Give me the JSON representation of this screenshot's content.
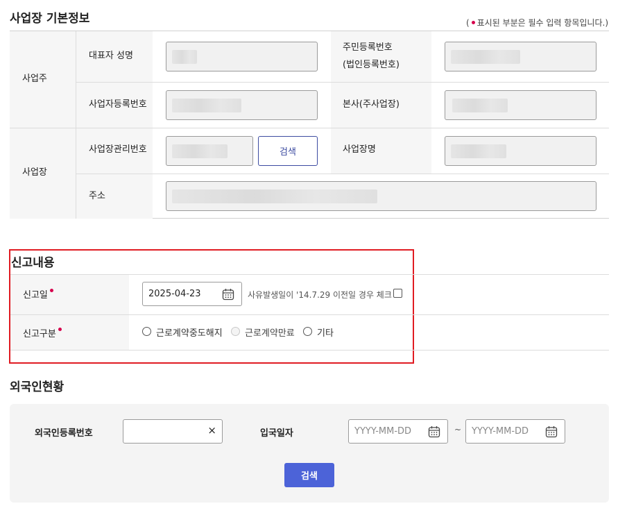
{
  "basic_info": {
    "title": "사업장 기본정보",
    "required_note": "표시된 부분은 필수 입력 항목입니다.",
    "required_note_open": "(",
    "required_note_close": ")",
    "owner_label": "사업주",
    "site_label": "사업장",
    "rep_name_label": "대표자 성명",
    "resident_no_label_1": "주민등록번호",
    "resident_no_label_2": "(법인등록번호)",
    "biz_reg_no_label": "사업자등록번호",
    "hq_label": "본사(주사업장)",
    "site_mgmt_no_label": "사업장관리번호",
    "search_button": "검색",
    "site_name_label": "사업장명",
    "address_label": "주소"
  },
  "report": {
    "title": "신고내용",
    "date_label": "신고일",
    "date_value": "2025-04-23",
    "hint": "사유발생일이 '14.7.29 이전일 경우 체크",
    "type_label": "신고구분",
    "options": [
      "근로계약중도해지",
      "근로계약만료",
      "기타"
    ]
  },
  "foreign": {
    "title": "외국인현황",
    "reg_no_label": "외국인등록번호",
    "clear_icon": "×",
    "entry_date_label": "입국일자",
    "date_placeholder": "YYYY-MM-DD",
    "range_sep": "~",
    "search_button": "검색"
  },
  "colors": {
    "accent": "#4c63d8",
    "required_dot": "#d6004c",
    "highlight_border": "#e01b22"
  }
}
